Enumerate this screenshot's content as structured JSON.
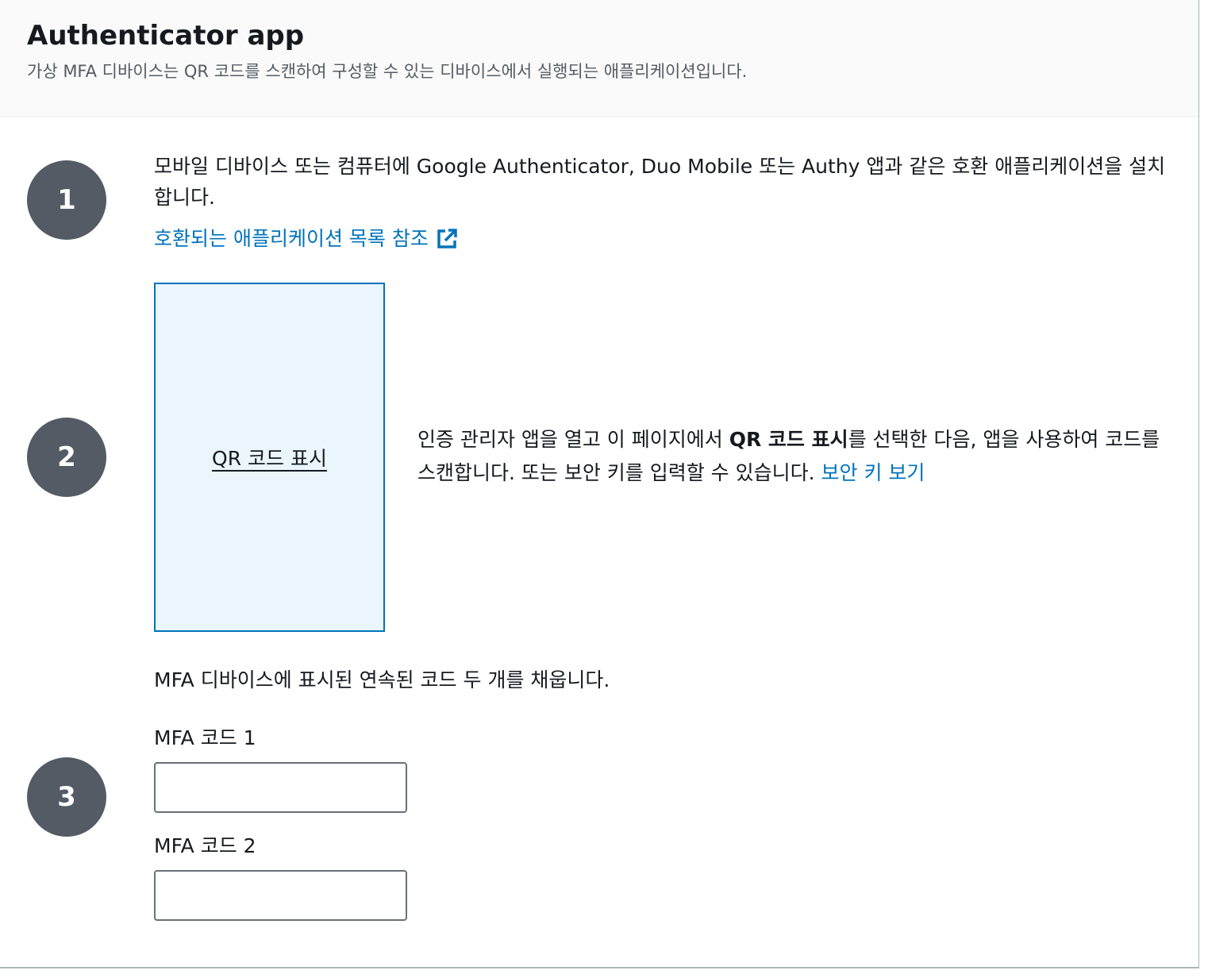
{
  "header": {
    "title": "Authenticator app",
    "description": "가상 MFA 디바이스는 QR 코드를 스캔하여 구성할 수 있는 디바이스에서 실행되는 애플리케이션입니다."
  },
  "steps": [
    {
      "number": "1",
      "text": "모바일 디바이스 또는 컴퓨터에 Google Authenticator, Duo Mobile 또는 Authy 앱과 같은 호환 애플리케이션을 설치합니다.",
      "link_label": "호환되는 애플리케이션 목록 참조",
      "link_icon": "external-link-icon"
    },
    {
      "number": "2",
      "qr_link_label": "QR 코드 표시",
      "text_before": "인증 관리자 앱을 열고 이 페이지에서 ",
      "text_bold": "QR 코드 표시",
      "text_after": "를 선택한 다음, 앱을 사용하여 코드를 스캔합니다. 또는 보안 키를 입력할 수 있습니다. ",
      "link_label": "보안 키 보기"
    },
    {
      "number": "3",
      "intro": "MFA 디바이스에 표시된 연속된 코드 두 개를 채웁니다.",
      "fields": [
        {
          "label": "MFA 코드 1",
          "value": ""
        },
        {
          "label": "MFA 코드 2",
          "value": ""
        }
      ]
    }
  ],
  "colors": {
    "link": "#0073bb",
    "step_circle": "#545b64",
    "qr_box_bg": "#eaf6fc"
  }
}
